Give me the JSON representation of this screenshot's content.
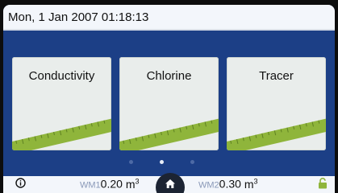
{
  "status_bar": {
    "datetime": "Mon, 1 Jan 2007 01:18:13"
  },
  "tiles": [
    {
      "label": "Conductivity",
      "icon": "ruler-icon"
    },
    {
      "label": "Chlorine",
      "icon": "ruler-icon"
    },
    {
      "label": "Tracer",
      "icon": "ruler-icon"
    }
  ],
  "pager": {
    "pages": 3,
    "active_page": 2
  },
  "bottom_bar": {
    "info_icon": "info-icon",
    "meters": [
      {
        "tag": "WM1",
        "value": "0.20",
        "unit": "m",
        "unit_exp": "3"
      },
      {
        "tag": "WM2",
        "value": "0.30",
        "unit": "m",
        "unit_exp": "3"
      }
    ],
    "home_icon": "home-icon",
    "lock_icon": "unlocked-padlock-icon"
  },
  "colors": {
    "background": "#1c3f86",
    "bar": "#f3f6fb",
    "ruler": "#8fb53b",
    "lock": "#8fb53b",
    "home_button": "#1c2433"
  }
}
